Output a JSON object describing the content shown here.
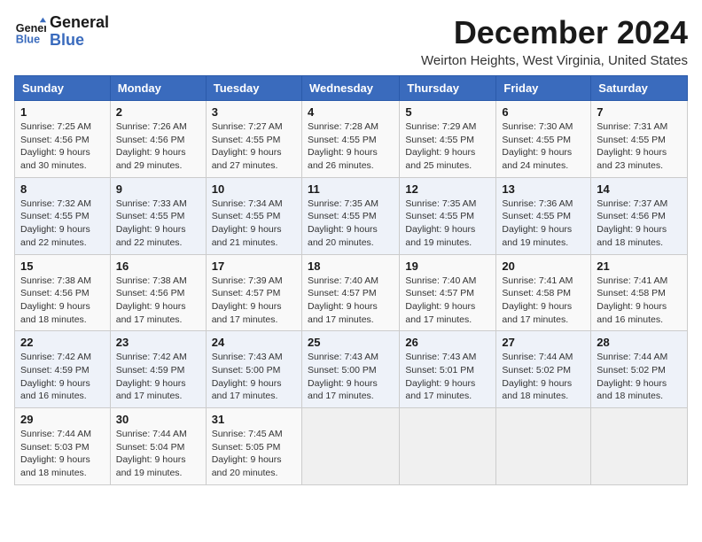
{
  "app": {
    "name_line1": "General",
    "name_line2": "Blue"
  },
  "header": {
    "month": "December 2024",
    "location": "Weirton Heights, West Virginia, United States"
  },
  "weekdays": [
    "Sunday",
    "Monday",
    "Tuesday",
    "Wednesday",
    "Thursday",
    "Friday",
    "Saturday"
  ],
  "weeks": [
    [
      {
        "day": "1",
        "sunrise": "Sunrise: 7:25 AM",
        "sunset": "Sunset: 4:56 PM",
        "daylight": "Daylight: 9 hours and 30 minutes."
      },
      {
        "day": "2",
        "sunrise": "Sunrise: 7:26 AM",
        "sunset": "Sunset: 4:56 PM",
        "daylight": "Daylight: 9 hours and 29 minutes."
      },
      {
        "day": "3",
        "sunrise": "Sunrise: 7:27 AM",
        "sunset": "Sunset: 4:55 PM",
        "daylight": "Daylight: 9 hours and 27 minutes."
      },
      {
        "day": "4",
        "sunrise": "Sunrise: 7:28 AM",
        "sunset": "Sunset: 4:55 PM",
        "daylight": "Daylight: 9 hours and 26 minutes."
      },
      {
        "day": "5",
        "sunrise": "Sunrise: 7:29 AM",
        "sunset": "Sunset: 4:55 PM",
        "daylight": "Daylight: 9 hours and 25 minutes."
      },
      {
        "day": "6",
        "sunrise": "Sunrise: 7:30 AM",
        "sunset": "Sunset: 4:55 PM",
        "daylight": "Daylight: 9 hours and 24 minutes."
      },
      {
        "day": "7",
        "sunrise": "Sunrise: 7:31 AM",
        "sunset": "Sunset: 4:55 PM",
        "daylight": "Daylight: 9 hours and 23 minutes."
      }
    ],
    [
      {
        "day": "8",
        "sunrise": "Sunrise: 7:32 AM",
        "sunset": "Sunset: 4:55 PM",
        "daylight": "Daylight: 9 hours and 22 minutes."
      },
      {
        "day": "9",
        "sunrise": "Sunrise: 7:33 AM",
        "sunset": "Sunset: 4:55 PM",
        "daylight": "Daylight: 9 hours and 22 minutes."
      },
      {
        "day": "10",
        "sunrise": "Sunrise: 7:34 AM",
        "sunset": "Sunset: 4:55 PM",
        "daylight": "Daylight: 9 hours and 21 minutes."
      },
      {
        "day": "11",
        "sunrise": "Sunrise: 7:35 AM",
        "sunset": "Sunset: 4:55 PM",
        "daylight": "Daylight: 9 hours and 20 minutes."
      },
      {
        "day": "12",
        "sunrise": "Sunrise: 7:35 AM",
        "sunset": "Sunset: 4:55 PM",
        "daylight": "Daylight: 9 hours and 19 minutes."
      },
      {
        "day": "13",
        "sunrise": "Sunrise: 7:36 AM",
        "sunset": "Sunset: 4:55 PM",
        "daylight": "Daylight: 9 hours and 19 minutes."
      },
      {
        "day": "14",
        "sunrise": "Sunrise: 7:37 AM",
        "sunset": "Sunset: 4:56 PM",
        "daylight": "Daylight: 9 hours and 18 minutes."
      }
    ],
    [
      {
        "day": "15",
        "sunrise": "Sunrise: 7:38 AM",
        "sunset": "Sunset: 4:56 PM",
        "daylight": "Daylight: 9 hours and 18 minutes."
      },
      {
        "day": "16",
        "sunrise": "Sunrise: 7:38 AM",
        "sunset": "Sunset: 4:56 PM",
        "daylight": "Daylight: 9 hours and 17 minutes."
      },
      {
        "day": "17",
        "sunrise": "Sunrise: 7:39 AM",
        "sunset": "Sunset: 4:57 PM",
        "daylight": "Daylight: 9 hours and 17 minutes."
      },
      {
        "day": "18",
        "sunrise": "Sunrise: 7:40 AM",
        "sunset": "Sunset: 4:57 PM",
        "daylight": "Daylight: 9 hours and 17 minutes."
      },
      {
        "day": "19",
        "sunrise": "Sunrise: 7:40 AM",
        "sunset": "Sunset: 4:57 PM",
        "daylight": "Daylight: 9 hours and 17 minutes."
      },
      {
        "day": "20",
        "sunrise": "Sunrise: 7:41 AM",
        "sunset": "Sunset: 4:58 PM",
        "daylight": "Daylight: 9 hours and 17 minutes."
      },
      {
        "day": "21",
        "sunrise": "Sunrise: 7:41 AM",
        "sunset": "Sunset: 4:58 PM",
        "daylight": "Daylight: 9 hours and 16 minutes."
      }
    ],
    [
      {
        "day": "22",
        "sunrise": "Sunrise: 7:42 AM",
        "sunset": "Sunset: 4:59 PM",
        "daylight": "Daylight: 9 hours and 16 minutes."
      },
      {
        "day": "23",
        "sunrise": "Sunrise: 7:42 AM",
        "sunset": "Sunset: 4:59 PM",
        "daylight": "Daylight: 9 hours and 17 minutes."
      },
      {
        "day": "24",
        "sunrise": "Sunrise: 7:43 AM",
        "sunset": "Sunset: 5:00 PM",
        "daylight": "Daylight: 9 hours and 17 minutes."
      },
      {
        "day": "25",
        "sunrise": "Sunrise: 7:43 AM",
        "sunset": "Sunset: 5:00 PM",
        "daylight": "Daylight: 9 hours and 17 minutes."
      },
      {
        "day": "26",
        "sunrise": "Sunrise: 7:43 AM",
        "sunset": "Sunset: 5:01 PM",
        "daylight": "Daylight: 9 hours and 17 minutes."
      },
      {
        "day": "27",
        "sunrise": "Sunrise: 7:44 AM",
        "sunset": "Sunset: 5:02 PM",
        "daylight": "Daylight: 9 hours and 18 minutes."
      },
      {
        "day": "28",
        "sunrise": "Sunrise: 7:44 AM",
        "sunset": "Sunset: 5:02 PM",
        "daylight": "Daylight: 9 hours and 18 minutes."
      }
    ],
    [
      {
        "day": "29",
        "sunrise": "Sunrise: 7:44 AM",
        "sunset": "Sunset: 5:03 PM",
        "daylight": "Daylight: 9 hours and 18 minutes."
      },
      {
        "day": "30",
        "sunrise": "Sunrise: 7:44 AM",
        "sunset": "Sunset: 5:04 PM",
        "daylight": "Daylight: 9 hours and 19 minutes."
      },
      {
        "day": "31",
        "sunrise": "Sunrise: 7:45 AM",
        "sunset": "Sunset: 5:05 PM",
        "daylight": "Daylight: 9 hours and 20 minutes."
      },
      null,
      null,
      null,
      null
    ]
  ]
}
